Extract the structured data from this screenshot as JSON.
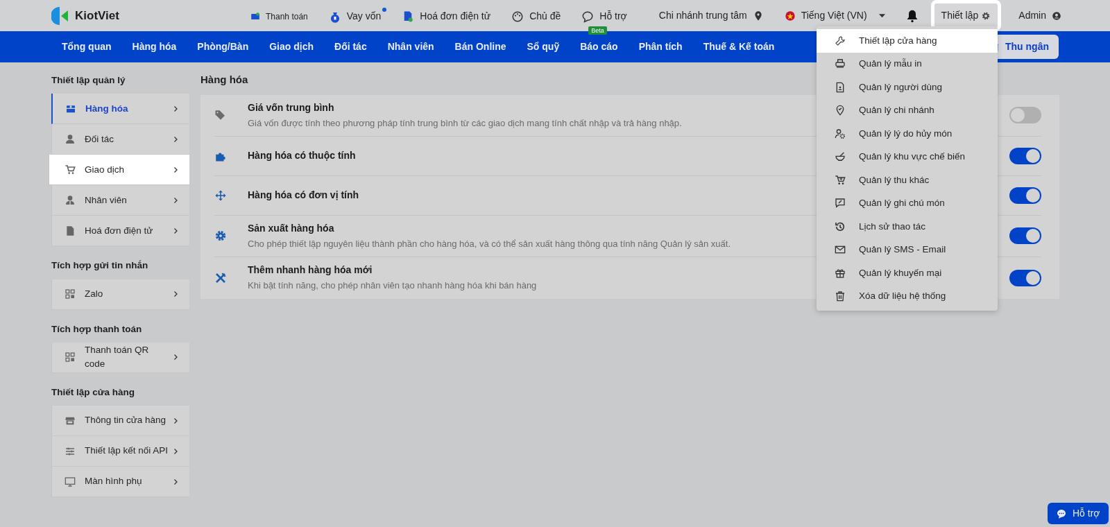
{
  "logo": {
    "text": "KiotViet"
  },
  "top_links": [
    {
      "label": "Thanh toán",
      "small": true,
      "dot": false
    },
    {
      "label": "Vay vốn",
      "small": false,
      "dot": true
    },
    {
      "label": "Hoá đơn điện tử",
      "small": false,
      "dot": false
    },
    {
      "label": "Chủ đề",
      "small": false,
      "dot": false
    },
    {
      "label": "Hỗ trợ",
      "small": false,
      "dot": false,
      "badge": "Beta"
    }
  ],
  "branch": "Chi nhánh trung tâm",
  "language": "Tiếng Việt (VN)",
  "settings_button": {
    "label": "Thiết lập",
    "highlighted": true
  },
  "user": "Admin",
  "nav": [
    "Tổng quan",
    "Hàng hóa",
    "Phòng/Bàn",
    "Giao dịch",
    "Đối tác",
    "Nhân viên",
    "Bán Online",
    "Sổ quỹ",
    "Báo cáo",
    "Phân tích",
    "Thuế & Kế toán"
  ],
  "cashier_button": "Thu ngân",
  "sidebar": [
    {
      "title": "Thiết lập quản lý",
      "items": [
        {
          "label": "Hàng hóa",
          "selected": true,
          "highlighted": false
        },
        {
          "label": "Đối tác",
          "selected": false,
          "highlighted": false
        },
        {
          "label": "Giao dịch",
          "selected": false,
          "highlighted": true
        },
        {
          "label": "Nhân viên",
          "selected": false,
          "highlighted": false
        },
        {
          "label": "Hoá đơn điện tử",
          "selected": false,
          "highlighted": false
        }
      ]
    },
    {
      "title": "Tích hợp gửi tin nhắn",
      "items": [
        {
          "label": "Zalo",
          "selected": false,
          "highlighted": false
        }
      ]
    },
    {
      "title": "Tích hợp thanh toán",
      "items": [
        {
          "label": "Thanh toán QR code",
          "selected": false,
          "highlighted": false
        }
      ]
    },
    {
      "title": "Thiết lập cửa hàng",
      "items": [
        {
          "label": "Thông tin cửa hàng",
          "selected": false,
          "highlighted": false
        },
        {
          "label": "Thiết lập kết nối API",
          "selected": false,
          "highlighted": false
        },
        {
          "label": "Màn hình phụ",
          "selected": false,
          "highlighted": false
        }
      ]
    }
  ],
  "content": {
    "title": "Hàng hóa",
    "settings": [
      {
        "title": "Giá vốn trung bình",
        "description": "Giá vốn được tính theo phương pháp tính trung bình từ các giao dịch mang tính chất nhập và trả hàng nhập.",
        "on": false
      },
      {
        "title": "Hàng hóa có thuộc tính",
        "on": true
      },
      {
        "title": "Hàng hóa có đơn vị tính",
        "on": true
      },
      {
        "title": "Sản xuất hàng hóa",
        "description": "Cho phép thiết lập nguyên liệu thành phần cho hàng hóa, và có thể sản xuất hàng thông qua tính năng Quản lý sản xuất.",
        "on": true
      },
      {
        "title": "Thêm nhanh hàng hóa mới",
        "description": "Khi bật tính năng, cho phép nhân viên tạo nhanh hàng hóa khi bán hàng",
        "on": true
      }
    ]
  },
  "settings_menu": [
    {
      "label": "Thiết lập cửa hàng",
      "highlighted": true
    },
    {
      "label": "Quản lý mẫu in",
      "highlighted": false
    },
    {
      "label": "Quản lý người dùng",
      "highlighted": false
    },
    {
      "label": "Quản lý chi nhánh",
      "highlighted": false
    },
    {
      "label": "Quản lý lý do hủy món",
      "highlighted": false
    },
    {
      "label": "Quản lý khu vực chế biến",
      "highlighted": false
    },
    {
      "label": "Quản lý thu khác",
      "highlighted": false
    },
    {
      "label": "Quản lý ghi chú món",
      "highlighted": false
    },
    {
      "label": "Lịch sử thao tác",
      "highlighted": false
    },
    {
      "label": "Quản lý SMS - Email",
      "highlighted": false
    },
    {
      "label": "Quản lý khuyến mại",
      "highlighted": false
    },
    {
      "label": "Xóa dữ liệu hệ thống",
      "highlighted": false
    }
  ],
  "help_button": "Hỗ trợ"
}
